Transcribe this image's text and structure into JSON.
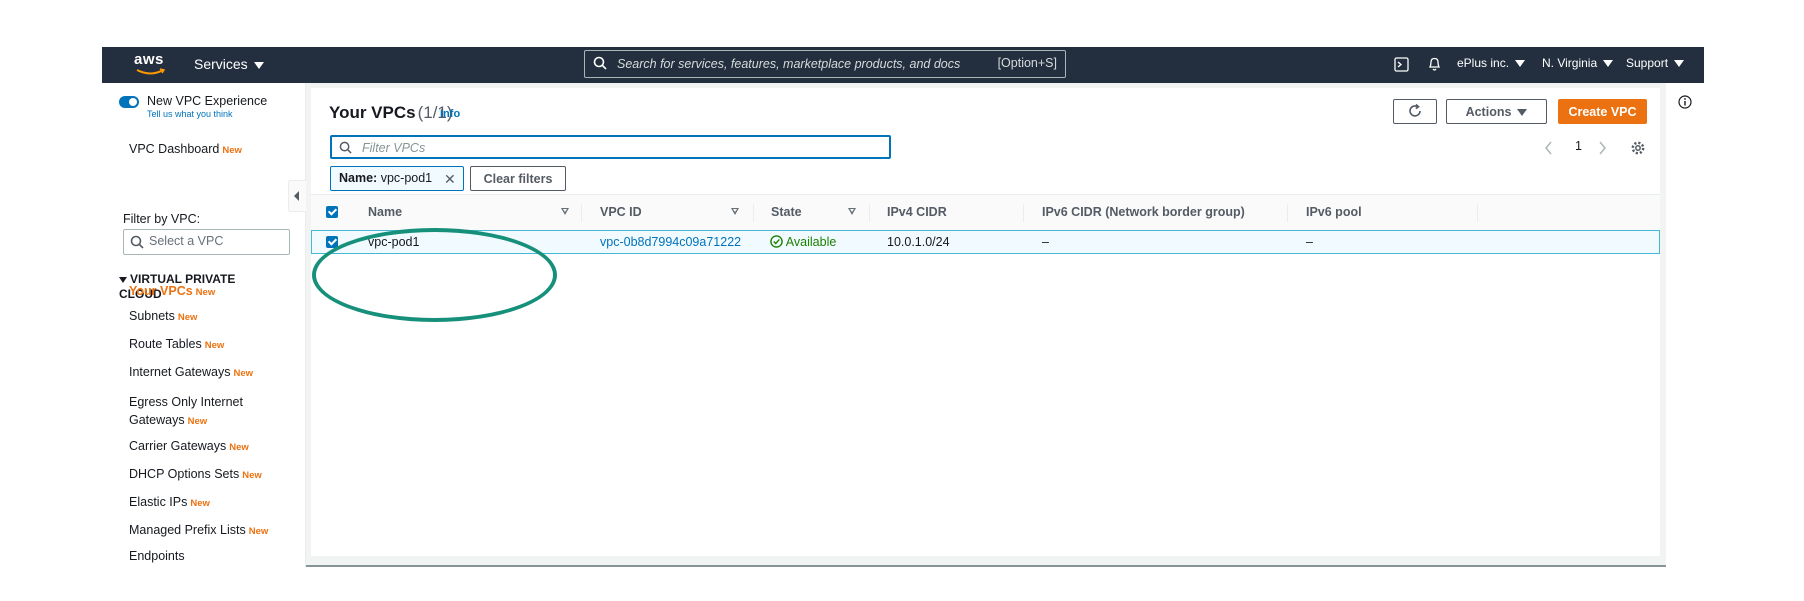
{
  "nav": {
    "logo": "aws",
    "services": "Services",
    "search_placeholder": "Search for services, features, marketplace products, and docs",
    "search_shortcut": "[Option+S]",
    "account": "ePlus inc.",
    "region": "N. Virginia",
    "support": "Support"
  },
  "sidebar": {
    "new_vpc_experience": "New VPC Experience",
    "tell_us": "Tell us what you think",
    "dashboard": "VPC Dashboard",
    "filter_label": "Filter by VPC:",
    "select_placeholder": "Select a VPC",
    "section": "VIRTUAL PRIVATE CLOUD",
    "new_badge": "New",
    "items": [
      {
        "label": "Your VPCs",
        "active": true
      },
      {
        "label": "Subnets"
      },
      {
        "label": "Route Tables"
      },
      {
        "label": "Internet Gateways"
      },
      {
        "label": "Egress Only Internet",
        "label2": "Gateways"
      },
      {
        "label": "Carrier Gateways"
      },
      {
        "label": "DHCP Options Sets"
      },
      {
        "label": "Elastic IPs"
      },
      {
        "label": "Managed Prefix Lists"
      },
      {
        "label": "Endpoints"
      }
    ]
  },
  "main": {
    "title": "Your VPCs",
    "count": "(1/1)",
    "info": "Info",
    "refresh_icon": "refresh-icon",
    "actions": "Actions",
    "create": "Create VPC",
    "filter_placeholder": "Filter VPCs",
    "page": "1",
    "token_key": "Name:",
    "token_value": "vpc-pod1",
    "clear_filters": "Clear filters"
  },
  "table": {
    "columns": [
      "Name",
      "VPC ID",
      "State",
      "IPv4 CIDR",
      "IPv6 CIDR (Network border group)",
      "IPv6 pool"
    ],
    "rows": [
      {
        "name": "vpc-pod1",
        "vpc_id": "vpc-0b8d7994c09a71222",
        "state": "Available",
        "ipv4": "10.0.1.0/24",
        "ipv6": "–",
        "pool": "–"
      }
    ]
  },
  "colors": {
    "nav_bg": "#232f3e",
    "accent": "#ec7211",
    "link": "#0073bb",
    "success": "#1d8102",
    "annotation": "#16907a"
  }
}
